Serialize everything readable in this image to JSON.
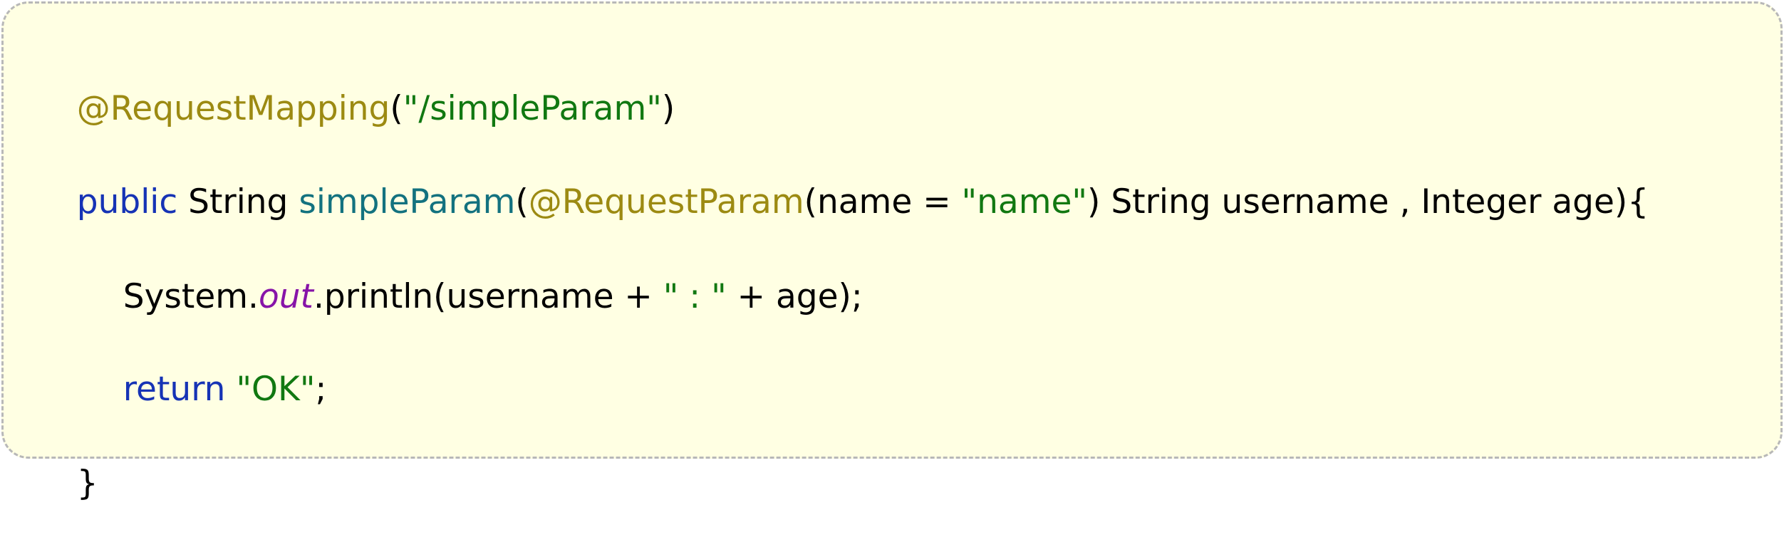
{
  "theme": {
    "background": "#ffffe3",
    "border": "#b8b8b8",
    "annotation": "#9c8a12",
    "string": "#117811",
    "keyword": "#1633b5",
    "method": "#13727f",
    "field": "#8714a8",
    "text": "#000000"
  },
  "code": {
    "line1": {
      "annotation": "@RequestMapping",
      "open": "(",
      "path": "\"/simpleParam\"",
      "close": ")"
    },
    "line2": {
      "keyword": "public",
      "type": " String ",
      "method": "simpleParam",
      "open": "(",
      "annotation": "@RequestParam",
      "params_open": "(name = ",
      "param_value": "\"name\"",
      "params_rest": ") String username , Integer age){"
    },
    "line3": {
      "class_name": "System.",
      "field": "out",
      "call": ".println(username + ",
      "separator": "\" : \"",
      "tail": " + age);"
    },
    "line4": {
      "keyword": "return",
      "space": " ",
      "value": "\"OK\"",
      "end": ";"
    },
    "line5": {
      "close_brace": "}"
    }
  }
}
